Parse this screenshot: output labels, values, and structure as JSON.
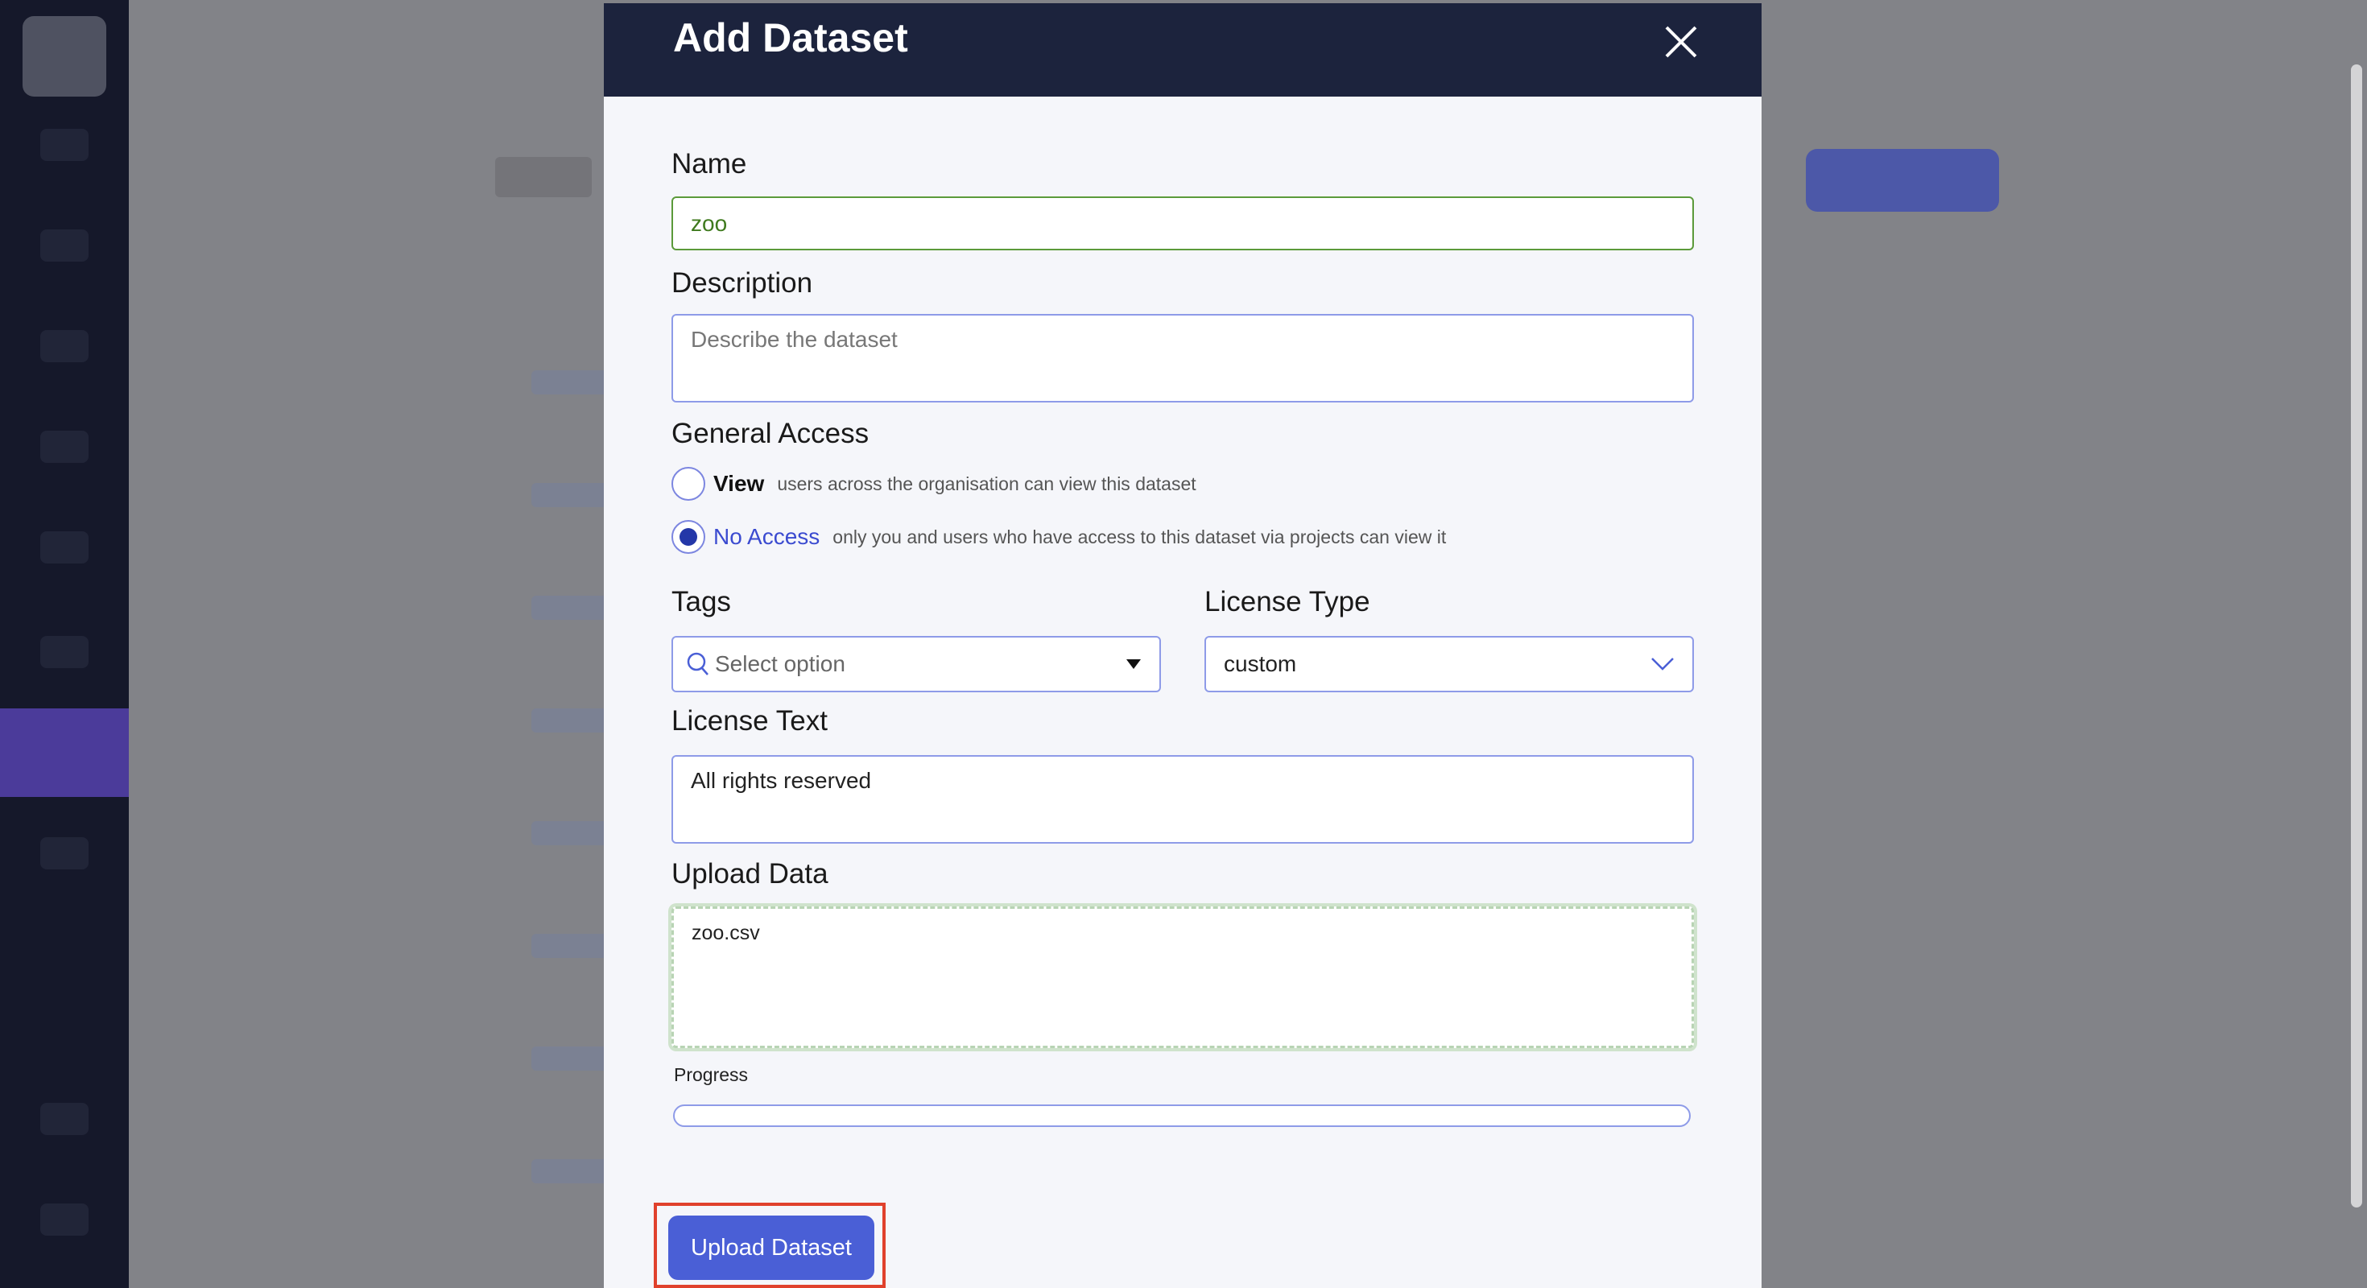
{
  "modal": {
    "title": "Add Dataset",
    "name_label": "Name",
    "name_value": "zoo",
    "description_label": "Description",
    "description_placeholder": "Describe the dataset",
    "general_access_label": "General Access",
    "access_options": [
      {
        "label": "View",
        "description": "users across the organisation can view this dataset",
        "selected": false
      },
      {
        "label": "No Access",
        "description": "only you and users who have access to this dataset via projects can view it",
        "selected": true
      }
    ],
    "tags_label": "Tags",
    "tags_placeholder": "Select option",
    "license_type_label": "License Type",
    "license_type_value": "custom",
    "license_text_label": "License Text",
    "license_text_value": "All rights reserved",
    "upload_label": "Upload Data",
    "upload_file": "zoo.csv",
    "progress_label": "Progress",
    "progress_percent": 0,
    "submit_label": "Upload Dataset"
  },
  "colors": {
    "header": "#1c233d",
    "accent": "#4a5fd6",
    "highlight": "#e0412c",
    "name_valid": "#3f7a1e"
  }
}
